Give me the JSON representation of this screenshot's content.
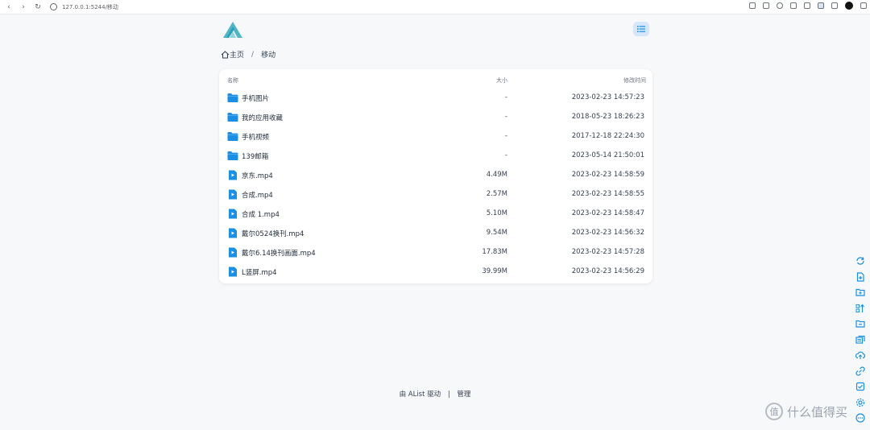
{
  "browser": {
    "url": "127.0.0.1:5244/移动"
  },
  "breadcrumb": {
    "home_label": "主页",
    "separator": "/",
    "current": "移动"
  },
  "table": {
    "headers": {
      "name": "名称",
      "size": "大小",
      "modified": "修改时间"
    },
    "rows": [
      {
        "type": "folder",
        "name": "手机图片",
        "size": "-",
        "modified": "2023-02-23 14:57:23"
      },
      {
        "type": "folder",
        "name": "我的应用收藏",
        "size": "-",
        "modified": "2018-05-23 18:26:23"
      },
      {
        "type": "folder",
        "name": "手机视频",
        "size": "-",
        "modified": "2017-12-18 22:24:30"
      },
      {
        "type": "folder",
        "name": "139邮箱",
        "size": "-",
        "modified": "2023-05-14 21:50:01"
      },
      {
        "type": "video",
        "name": "京东.mp4",
        "size": "4.49M",
        "modified": "2023-02-23 14:58:59"
      },
      {
        "type": "video",
        "name": "合成.mp4",
        "size": "2.57M",
        "modified": "2023-02-23 14:58:55"
      },
      {
        "type": "video",
        "name": "合成 1.mp4",
        "size": "5.10M",
        "modified": "2023-02-23 14:58:47"
      },
      {
        "type": "video",
        "name": "戴尔0524换刊.mp4",
        "size": "9.54M",
        "modified": "2023-02-23 14:56:32"
      },
      {
        "type": "video",
        "name": "戴尔6.14换刊画面.mp4",
        "size": "17.83M",
        "modified": "2023-02-23 14:57:28"
      },
      {
        "type": "video",
        "name": "L竖屏.mp4",
        "size": "39.99M",
        "modified": "2023-02-23 14:56:29"
      }
    ]
  },
  "footer": {
    "powered": "由 AList 驱动",
    "separator": "|",
    "manage": "管理"
  },
  "watermark": {
    "icon_text": "值",
    "text": "什么值得买"
  },
  "colors": {
    "accent": "#1a8fe3",
    "folder": "#1a8fe3",
    "logo": "#4fb6c9",
    "menu_bg": "#d6e6fb"
  },
  "side_tools": [
    "refresh-icon",
    "new-file-icon",
    "new-folder-icon",
    "sort-icon",
    "move-icon",
    "copy-icon",
    "upload-icon",
    "link-icon",
    "check-icon",
    "settings-icon",
    "more-icon"
  ]
}
